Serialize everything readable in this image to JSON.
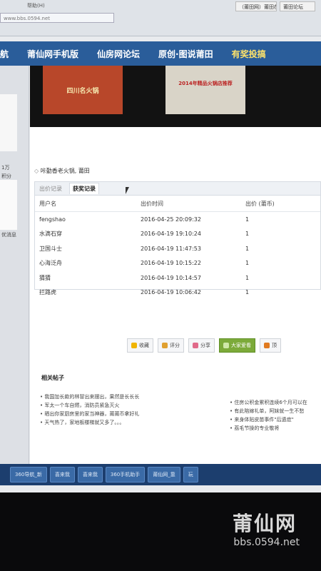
{
  "browser": {
    "menu": [
      "帮助(H)"
    ],
    "address": "www.bbs.0594.net",
    "tabs": [
      "（莆田网）莆田在线",
      "莆田论坛"
    ]
  },
  "nav": {
    "items": [
      "航",
      "莆仙网手机版",
      "仙房网论坛",
      "原创·图说莆田",
      "有奖投搞"
    ]
  },
  "banner": {
    "poster1": "四川名火锅",
    "poster2": "2014年精品火锅店推荐"
  },
  "left": {
    "line1": "1万",
    "line2": "积分",
    "line3": "优消息"
  },
  "page": {
    "crumb": "咔勤香老火锅, 莆田",
    "tabs": {
      "bid_history": "出价记录",
      "prize_history": "获奖记录"
    },
    "table": {
      "headers": [
        "用户名",
        "出价时间",
        "出价 (莆币)"
      ],
      "rows": [
        [
          "fengshao",
          "2016-04-25 20:09:32",
          "1"
        ],
        [
          "水滴石穿",
          "2016-04-19 19:10:24",
          "1"
        ],
        [
          "卫国斗士",
          "2016-04-19 11:47:53",
          "1"
        ],
        [
          "心海泛舟",
          "2016-04-19 10:15:22",
          "1"
        ],
        [
          "猜猜",
          "2016-04-19 10:14:57",
          "1"
        ],
        [
          "拦路虎",
          "2016-04-19 10:06:42",
          "1"
        ]
      ]
    },
    "actions": [
      "收藏",
      "评分",
      "分享",
      "大家爱看",
      "顶"
    ],
    "related_title": "相关帖子",
    "related_left": [
      "• 我国加长款的林冒出来摆出，果然是长长长",
      "• 军太一个车自燃，消防员紧急灭火",
      "• 晒出你家厨房里的家当神器，莆莆币拿好礼",
      "• 天气热了，家地板楼梯就又多了。。。"
    ],
    "related_right": [
      "• 住房公积金累积连续6个月可以在",
      "• 有此陪嫁礼单，阿妹就一生不愁",
      "• 来身体贴皮苗事件\"后遗症\"",
      "• 荔毛节操的专业敬将"
    ]
  },
  "taskbar": [
    "360导航_新",
    "喜来我",
    "喜来我",
    "360手机助手",
    "莆仙网_靠",
    "玩"
  ],
  "watermark": {
    "logo": "莆仙网",
    "url": "bbs.0594.net"
  },
  "colors": {
    "nav": "#2a5d9a",
    "taskbar": "#1c3e6e",
    "accent_green": "#7caa3a"
  }
}
